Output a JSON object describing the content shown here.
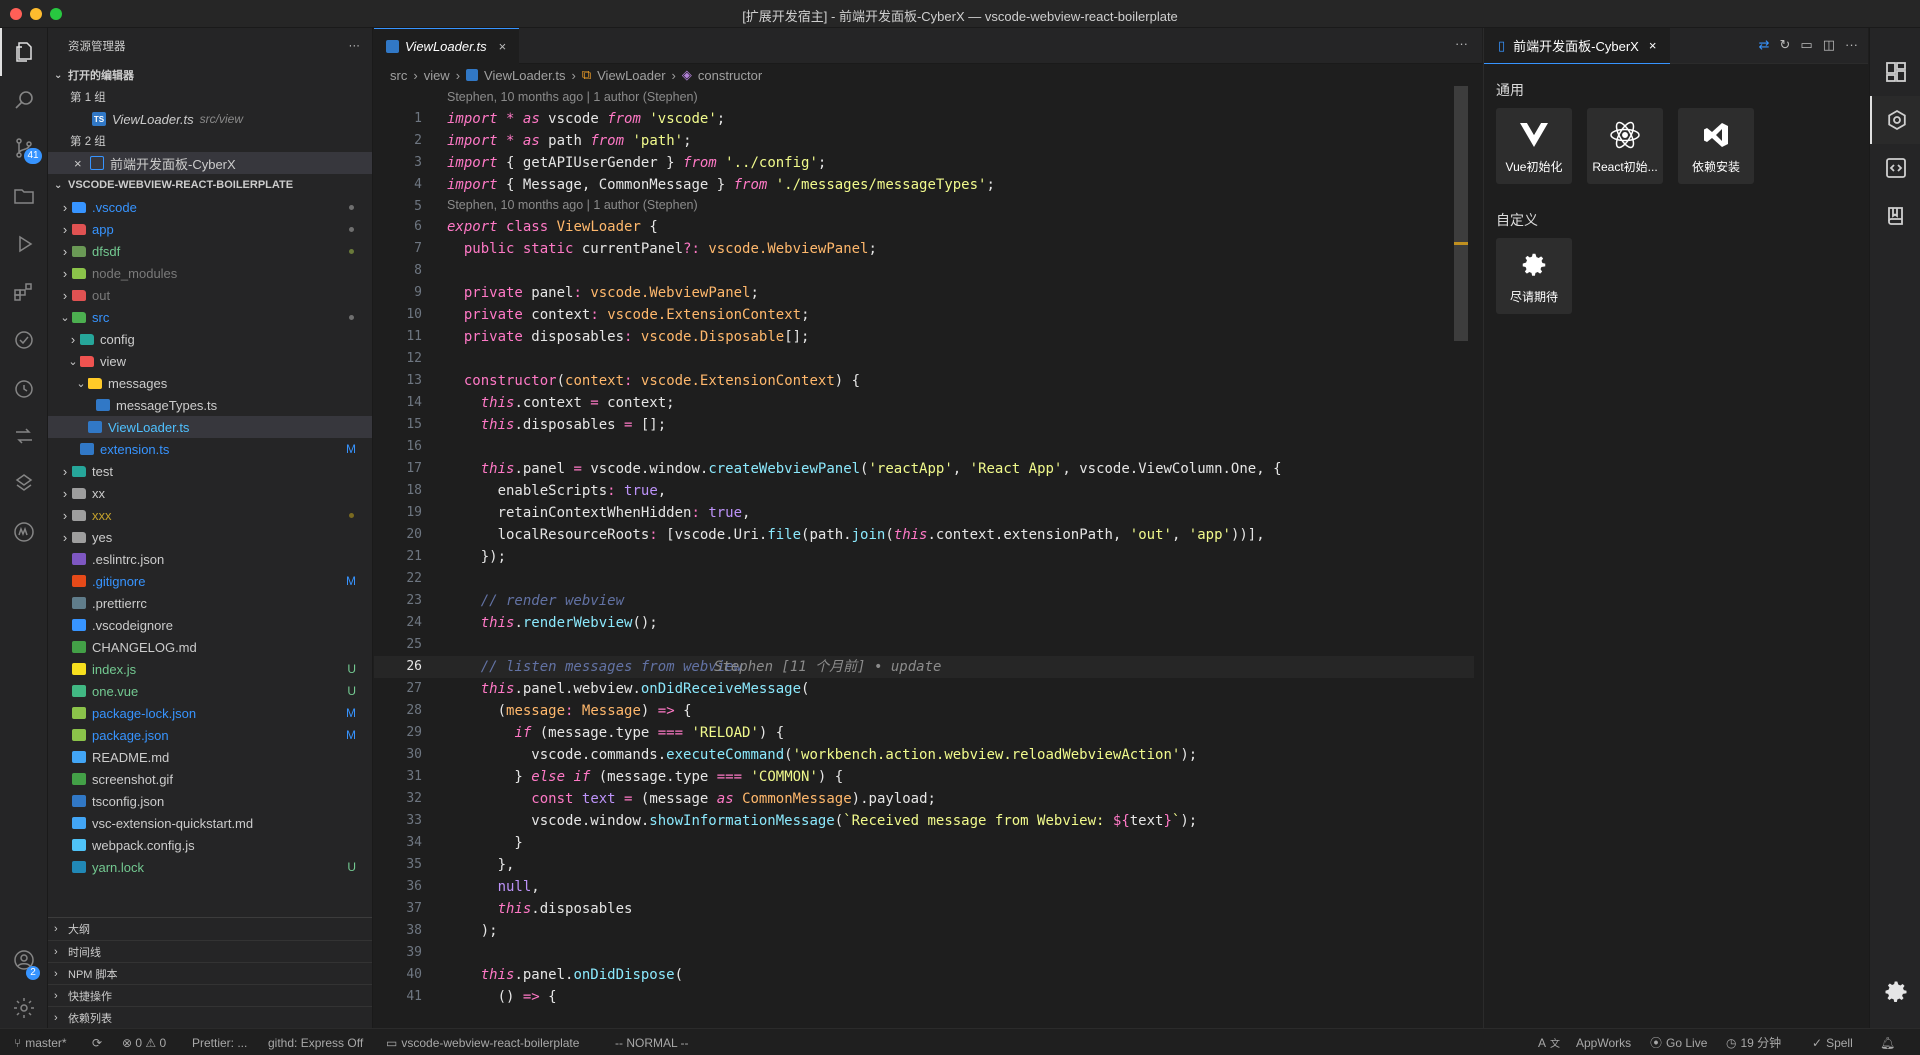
{
  "window": {
    "title": "[扩展开发宿主] - 前端开发面板-CyberX — vscode-webview-react-boilerplate"
  },
  "activity": {
    "scm_badge": "41",
    "account_badge": "2"
  },
  "sidebar": {
    "title": "资源管理器",
    "more": "···",
    "open_editors": "打开的编辑器",
    "group1": "第 1 组",
    "group1_file": "ViewLoader.ts",
    "group1_file_desc": "src/view",
    "group2": "第 2 组",
    "group2_file": "前端开发面板-CyberX",
    "project": "VSCODE-WEBVIEW-REACT-BOILERPLATE",
    "tree": [
      {
        "name": ".vscode",
        "color": "#3794ff"
      },
      {
        "name": "app",
        "color": "#3794ff"
      },
      {
        "name": "dfsdf",
        "color": "#73c991"
      },
      {
        "name": "node_modules",
        "color": "#7a7a7a"
      },
      {
        "name": "out",
        "color": "#7a7a7a"
      },
      {
        "name": "src",
        "color": "#3794ff"
      },
      {
        "name": "config",
        "color": "#cccccc"
      },
      {
        "name": "view",
        "color": "#cccccc"
      },
      {
        "name": "messages",
        "color": "#cccccc"
      },
      {
        "name": "messageTypes.ts",
        "color": "#cccccc"
      },
      {
        "name": "ViewLoader.ts",
        "color": "#4fc1ff"
      },
      {
        "name": "extension.ts",
        "color": "#3794ff",
        "status": "M"
      },
      {
        "name": "test",
        "color": "#cccccc"
      },
      {
        "name": "xx",
        "color": "#cccccc"
      },
      {
        "name": "xxx",
        "color": "#c5a22c"
      },
      {
        "name": "yes",
        "color": "#cccccc"
      },
      {
        "name": ".eslintrc.json",
        "color": "#cccccc"
      },
      {
        "name": ".gitignore",
        "color": "#3794ff",
        "status": "M"
      },
      {
        "name": ".prettierrc",
        "color": "#cccccc"
      },
      {
        "name": ".vscodeignore",
        "color": "#cccccc"
      },
      {
        "name": "CHANGELOG.md",
        "color": "#cccccc"
      },
      {
        "name": "index.js",
        "color": "#73c991",
        "status": "U"
      },
      {
        "name": "one.vue",
        "color": "#73c991",
        "status": "U"
      },
      {
        "name": "package-lock.json",
        "color": "#3794ff",
        "status": "M"
      },
      {
        "name": "package.json",
        "color": "#3794ff",
        "status": "M"
      },
      {
        "name": "README.md",
        "color": "#cccccc"
      },
      {
        "name": "screenshot.gif",
        "color": "#cccccc"
      },
      {
        "name": "tsconfig.json",
        "color": "#cccccc"
      },
      {
        "name": "vsc-extension-quickstart.md",
        "color": "#cccccc"
      },
      {
        "name": "webpack.config.js",
        "color": "#cccccc"
      },
      {
        "name": "yarn.lock",
        "color": "#73c991",
        "status": "U"
      }
    ],
    "bottom_sections": [
      "大纲",
      "时间线",
      "NPM 脚本",
      "快捷操作",
      "依赖列表"
    ]
  },
  "editor": {
    "tab_label": "ViewLoader.ts",
    "tab_close": "×",
    "more": "···",
    "breadcrumb": [
      "src",
      "view",
      "ViewLoader.ts",
      "ViewLoader",
      "constructor"
    ],
    "blame1": "Stephen, 10 months ago | 1 author (Stephen)",
    "blame2": "Stephen, 10 months ago | 1 author (Stephen)",
    "inline_blame": "Stephen [11 个月前] • update",
    "line_numbers": [
      "1",
      "2",
      "3",
      "4",
      "5",
      "6",
      "7",
      "8",
      "9",
      "10",
      "11",
      "12",
      "13",
      "14",
      "15",
      "16",
      "17",
      "18",
      "19",
      "20",
      "21",
      "22",
      "23",
      "24",
      "25",
      "26",
      "27",
      "28",
      "29",
      "30",
      "31",
      "32",
      "33",
      "34",
      "35",
      "36",
      "37",
      "38",
      "39",
      "40",
      "41"
    ],
    "current_line": "26"
  },
  "panel": {
    "tab_label": "前端开发面板-CyberX",
    "tab_close": "×",
    "section_general": "通用",
    "section_custom": "自定义",
    "cards": [
      "Vue初始化",
      "React初始...",
      "依赖安装"
    ],
    "custom_cards": [
      "尽请期待"
    ]
  },
  "status": {
    "branch": "master*",
    "problems": "⊗ 0 ⚠ 0",
    "prettier": "Prettier: ...",
    "githd": "githd: Express Off",
    "folder": "vscode-webview-react-boilerplate",
    "mode": "-- NORMAL --",
    "lang": "A",
    "appworks": "AppWorks",
    "golive": "Go Live",
    "time": "19 分钟",
    "spell": "Spell"
  }
}
